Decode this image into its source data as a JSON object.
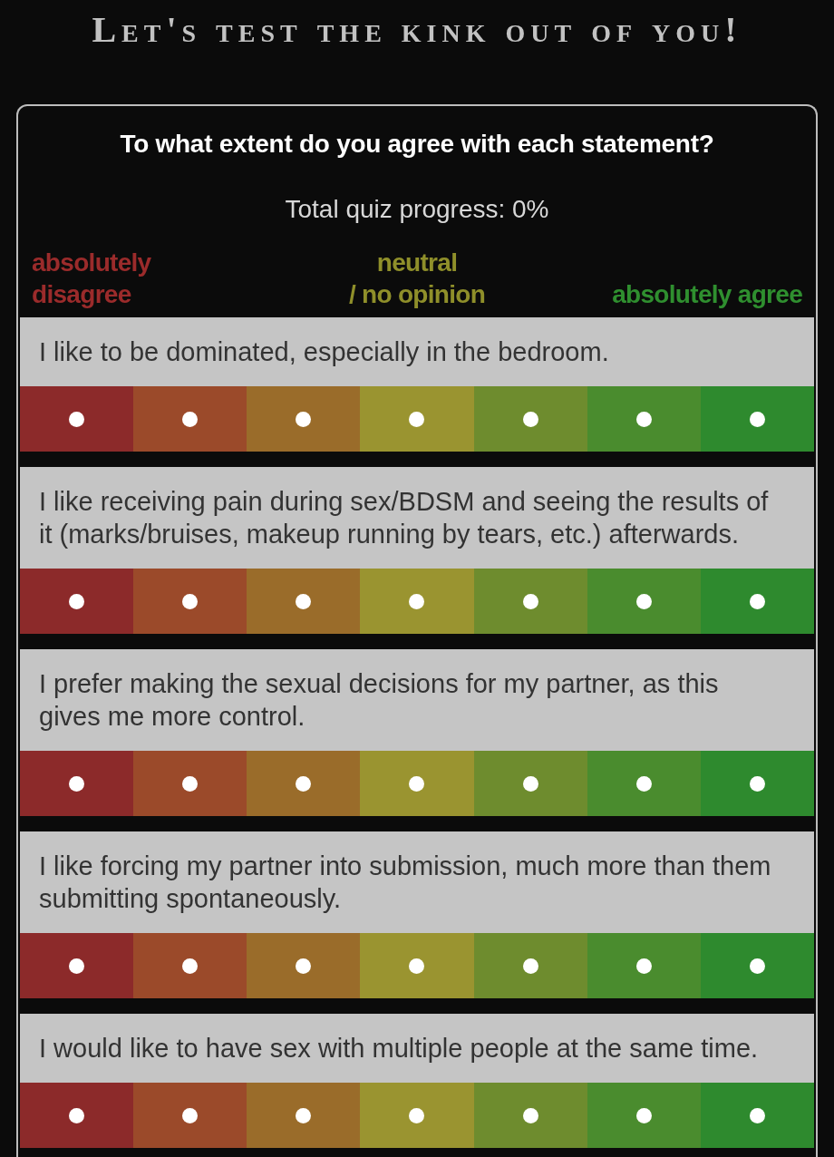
{
  "title": "Let's test the kink out of you!",
  "quiz": {
    "instruction": "To what extent do you agree with each statement?",
    "progress": "Total quiz progress: 0%",
    "scale_labels": [
      {
        "text": "absolutely\ndisagree",
        "color": "#9b2b2b"
      },
      {
        "text": "neutral\n/ no opinion",
        "color": "#8f8f2a"
      },
      {
        "text": "absolutely agree",
        "color": "#2f8f2f"
      }
    ],
    "questions": [
      {
        "text": "I like to be dominated, especially in the bedroom.",
        "options": [
          {
            "color": "#8c2a2a",
            "selected": false
          },
          {
            "color": "#9b4a2a",
            "selected": false
          },
          {
            "color": "#9a6c2a",
            "selected": false
          },
          {
            "color": "#9a9430",
            "selected": false
          },
          {
            "color": "#6e8c2e",
            "selected": false
          },
          {
            "color": "#4a8c2e",
            "selected": false
          },
          {
            "color": "#2e8a2e",
            "selected": false
          }
        ]
      },
      {
        "text": "I like receiving pain during sex/BDSM and seeing the results of it (marks/bruises, makeup running by tears, etc.) afterwards.",
        "options": [
          {
            "color": "#8c2a2a",
            "selected": false
          },
          {
            "color": "#9b4a2a",
            "selected": false
          },
          {
            "color": "#9a6c2a",
            "selected": false
          },
          {
            "color": "#9a9430",
            "selected": false
          },
          {
            "color": "#6e8c2e",
            "selected": false
          },
          {
            "color": "#4a8c2e",
            "selected": false
          },
          {
            "color": "#2e8a2e",
            "selected": false
          }
        ]
      },
      {
        "text": "I prefer making the sexual decisions for my partner, as this gives me more control.",
        "options": [
          {
            "color": "#8c2a2a",
            "selected": false
          },
          {
            "color": "#9b4a2a",
            "selected": false
          },
          {
            "color": "#9a6c2a",
            "selected": false
          },
          {
            "color": "#9a9430",
            "selected": false
          },
          {
            "color": "#6e8c2e",
            "selected": false
          },
          {
            "color": "#4a8c2e",
            "selected": false
          },
          {
            "color": "#2e8a2e",
            "selected": false
          }
        ]
      },
      {
        "text": "I like forcing my partner into submission, much more than them submitting spontaneously.",
        "options": [
          {
            "color": "#8c2a2a",
            "selected": false
          },
          {
            "color": "#9b4a2a",
            "selected": false
          },
          {
            "color": "#9a6c2a",
            "selected": false
          },
          {
            "color": "#9a9430",
            "selected": false
          },
          {
            "color": "#6e8c2e",
            "selected": false
          },
          {
            "color": "#4a8c2e",
            "selected": false
          },
          {
            "color": "#2e8a2e",
            "selected": false
          }
        ]
      },
      {
        "text": "I would like to have sex with multiple people at the same time.",
        "options": [
          {
            "color": "#8c2a2a",
            "selected": false
          },
          {
            "color": "#9b4a2a",
            "selected": false
          },
          {
            "color": "#9a6c2a",
            "selected": false
          },
          {
            "color": "#9a9430",
            "selected": false
          },
          {
            "color": "#6e8c2e",
            "selected": false
          },
          {
            "color": "#4a8c2e",
            "selected": false
          },
          {
            "color": "#2e8a2e",
            "selected": false
          }
        ]
      }
    ]
  }
}
